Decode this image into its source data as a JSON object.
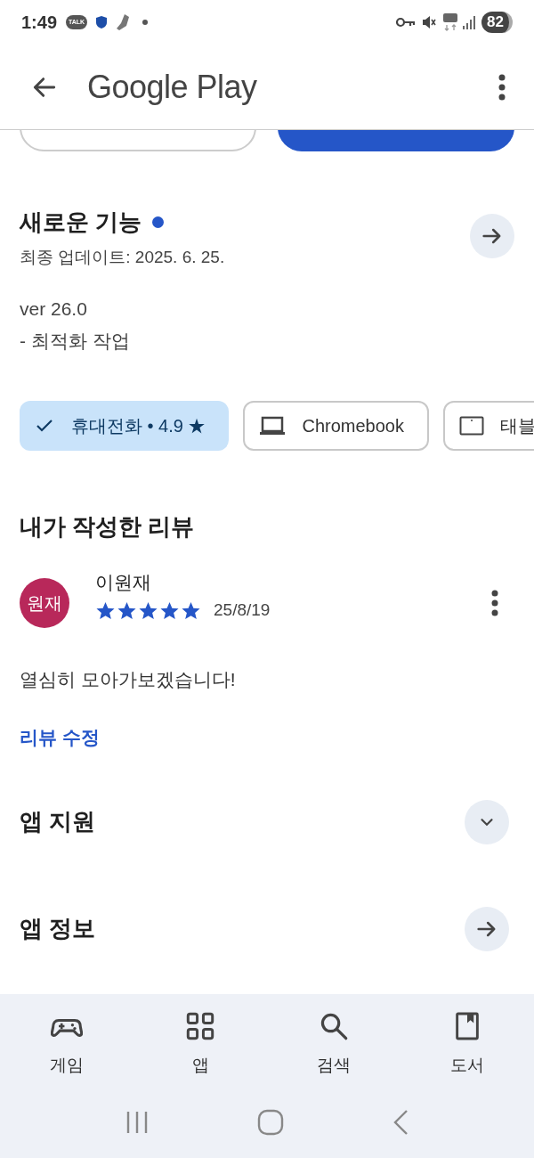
{
  "status_bar": {
    "time": "1:49",
    "notification_badge": "TALK",
    "battery": "82"
  },
  "app_bar": {
    "title": "Google Play"
  },
  "whats_new": {
    "title": "새로운 기능",
    "new_indicator": true,
    "updated": "최종 업데이트: 2025. 6. 25.",
    "lines": [
      "ver 26.0",
      "- 최적화 작업"
    ]
  },
  "device_chips": [
    {
      "label": "휴대전화 • 4.9 ★",
      "selected": true
    },
    {
      "kind": "laptop",
      "label": "Chromebook",
      "selected": false
    },
    {
      "kind": "tablet",
      "label": "태블",
      "selected": false
    }
  ],
  "my_review": {
    "title": "내가 작성한 리뷰",
    "avatar": "원재",
    "author": "이원재",
    "stars": 5,
    "date": "25/8/19",
    "text": "열심히 모아가보겠습니다!",
    "edit_link": "리뷰 수정"
  },
  "sections": [
    {
      "kind": "expand",
      "title": "앱 지원"
    },
    {
      "kind": "arrow",
      "title": "앱 정보"
    }
  ],
  "bottom_nav": [
    {
      "kind": "games",
      "label": "게임"
    },
    {
      "kind": "apps",
      "label": "앱"
    },
    {
      "kind": "search",
      "label": "검색"
    },
    {
      "kind": "books",
      "label": "도서"
    }
  ]
}
